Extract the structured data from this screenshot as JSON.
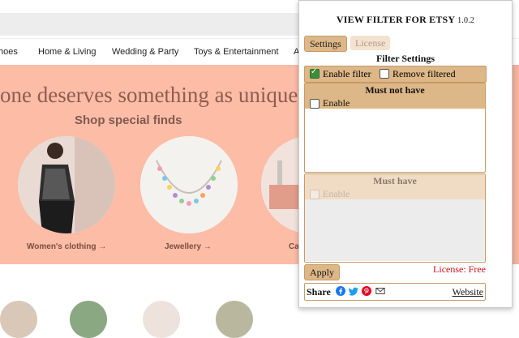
{
  "categories": [
    "hoes",
    "Home & Living",
    "Wedding & Party",
    "Toys & Entertainment",
    "A"
  ],
  "hero": {
    "headline": "one deserves something as unique a",
    "shop_title": "Shop special finds",
    "captions": [
      "Women's clothing",
      "Jewellery",
      "Ca"
    ]
  },
  "popup": {
    "title": "VIEW FILTER FOR ETSY",
    "version": "1.0.2",
    "tabs": [
      "Settings",
      "License"
    ],
    "filter_settings": "Filter Settings",
    "enable_filter": "Enable filter",
    "remove_filtered": "Remove filtered",
    "must_not_have": {
      "title": "Must not have",
      "enable": "Enable"
    },
    "must_have": {
      "title": "Must have",
      "enable": "Enable"
    },
    "apply": "Apply",
    "license_status": "License: Free",
    "share": "Share",
    "website": "Website",
    "icons": [
      "facebook-icon",
      "twitter-icon",
      "pinterest-icon",
      "mail-icon"
    ],
    "accent_color": "#ddb787",
    "license_color": "#d0101a"
  }
}
